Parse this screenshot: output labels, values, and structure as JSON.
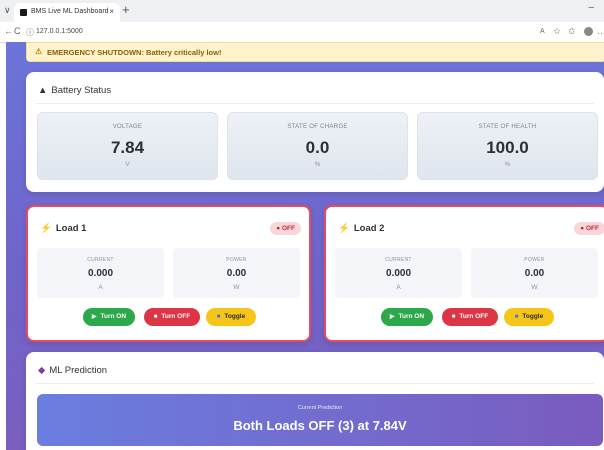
{
  "browser": {
    "tab_title": "BMS Live ML Dashboard",
    "tab_close": "×",
    "new_tab": "+",
    "url": "127.0.0.1:5000",
    "minimize": "–"
  },
  "alert": {
    "icon": "⚠",
    "message": "EMERGENCY SHUTDOWN: Battery critically low!"
  },
  "battery": {
    "title": "Battery Status",
    "metrics": [
      {
        "label": "VOLTAGE",
        "value": "7.84",
        "unit": "V"
      },
      {
        "label": "STATE OF CHARGE",
        "value": "0.0",
        "unit": "%"
      },
      {
        "label": "STATE OF HEALTH",
        "value": "100.0",
        "unit": "%"
      }
    ]
  },
  "loads": [
    {
      "title": "Load 1",
      "status": "● OFF",
      "current": {
        "label": "CURRENT",
        "value": "0.000",
        "unit": "A"
      },
      "power": {
        "label": "POWER",
        "value": "0.00",
        "unit": "W"
      },
      "buttons": {
        "on": "Turn ON",
        "off": "Turn OFF",
        "toggle": "Toggle"
      }
    },
    {
      "title": "Load 2",
      "status": "● OFF",
      "current": {
        "label": "CURRENT",
        "value": "0.000",
        "unit": "A"
      },
      "power": {
        "label": "POWER",
        "value": "0.00",
        "unit": "W"
      },
      "buttons": {
        "on": "Turn ON",
        "off": "Turn OFF",
        "toggle": "Toggle"
      }
    }
  ],
  "ml": {
    "title": "ML Prediction",
    "label": "Current Prediction",
    "prediction": "Both Loads OFF (3) at 7.84V"
  },
  "colors": {
    "accent_gradient_start": "#6b74d9",
    "accent_gradient_end": "#7a5fc0",
    "off_red": "#dc3545",
    "on_green": "#2aa84a",
    "toggle_yellow": "#f5c518",
    "alert_bg": "#fff3cd"
  }
}
